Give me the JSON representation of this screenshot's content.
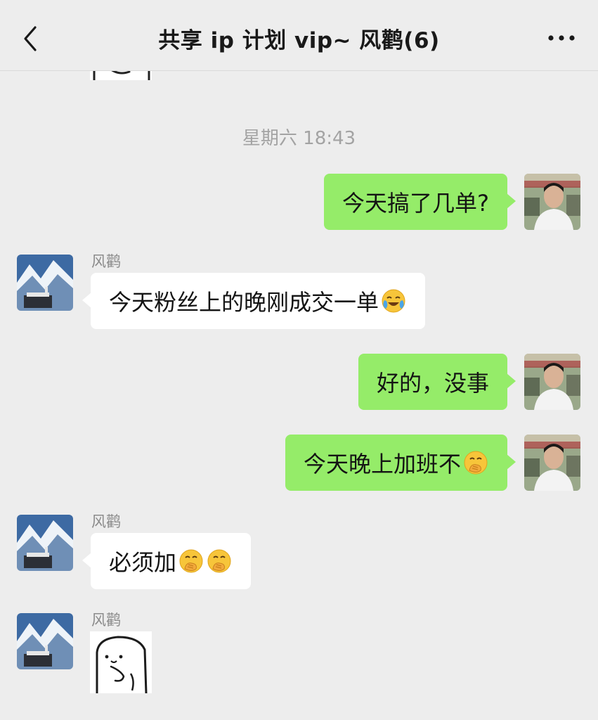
{
  "header": {
    "back_icon": "chevron-left-icon",
    "title": "共享 ip 计划 vip~ 风鹳(6)",
    "more_icon": "ellipsis-icon"
  },
  "timestamp": "星期六 18:43",
  "messages": [
    {
      "direction": "out",
      "text": "今天搞了几单?",
      "emoji": ""
    },
    {
      "direction": "in",
      "sender": "风鹳",
      "text": "今天粉丝上的晚刚成交一单",
      "emoji": "crying-laughing-emoji"
    },
    {
      "direction": "out",
      "text": "好的，没事",
      "emoji": ""
    },
    {
      "direction": "out",
      "text": "今天晚上加班不",
      "emoji": "hand-over-mouth-emoji"
    },
    {
      "direction": "in",
      "sender": "风鹳",
      "text": "必须加",
      "emoji": "hand-over-mouth-emoji x2"
    },
    {
      "direction": "in",
      "sender": "风鹳",
      "sticker": "bear-sticker"
    }
  ],
  "colors": {
    "background": "#ededed",
    "outgoing_bubble": "#95ec69",
    "incoming_bubble": "#ffffff",
    "sender_name": "#8b8b8b",
    "timestamp": "#a3a3a3"
  }
}
